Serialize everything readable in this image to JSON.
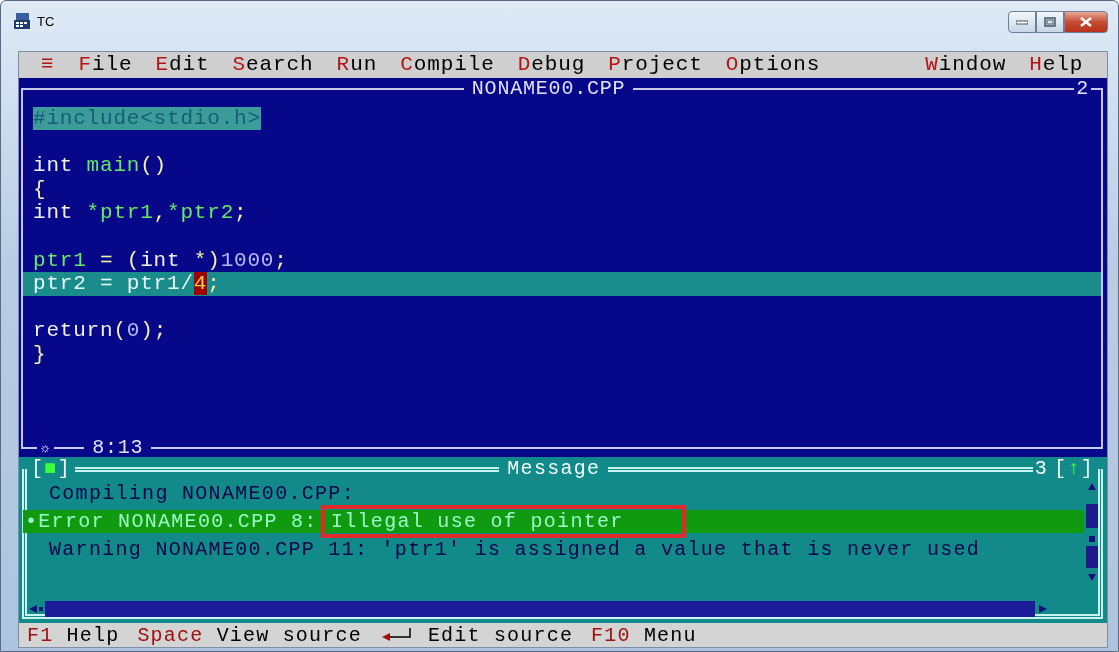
{
  "window": {
    "title": "TC"
  },
  "menu": [
    {
      "label": "≡",
      "kind": "system"
    },
    {
      "label": "File",
      "kind": "menu"
    },
    {
      "label": "Edit",
      "kind": "menu"
    },
    {
      "label": "Search",
      "kind": "menu"
    },
    {
      "label": "Run",
      "kind": "menu"
    },
    {
      "label": "Compile",
      "kind": "menu"
    },
    {
      "label": "Debug",
      "kind": "menu"
    },
    {
      "label": "Project",
      "kind": "menu"
    },
    {
      "label": "Options",
      "kind": "menu"
    },
    {
      "label": "Window",
      "kind": "right"
    },
    {
      "label": "Help",
      "kind": "menu"
    }
  ],
  "editor": {
    "title": "NONAME00.CPP",
    "number": "2",
    "modified_marker": "☼",
    "position": "8:13",
    "lines": [
      {
        "kind": "block",
        "tokens": [
          {
            "text": "#include<stdio.h>",
            "kind": "directive"
          }
        ]
      },
      {
        "kind": "blank"
      },
      {
        "kind": "normal",
        "tokens": [
          {
            "text": "int ",
            "kind": "keyword"
          },
          {
            "text": "main",
            "kind": "ident"
          },
          {
            "text": "()",
            "kind": "symbol"
          }
        ]
      },
      {
        "kind": "normal",
        "tokens": [
          {
            "text": "{",
            "kind": "symbol"
          }
        ]
      },
      {
        "kind": "normal",
        "tokens": [
          {
            "text": "int ",
            "kind": "keyword"
          },
          {
            "text": "*ptr1",
            "kind": "ident"
          },
          {
            "text": ",",
            "kind": "symbol"
          },
          {
            "text": "*ptr2",
            "kind": "ident"
          },
          {
            "text": ";",
            "kind": "symbol"
          }
        ]
      },
      {
        "kind": "blank"
      },
      {
        "kind": "normal",
        "tokens": [
          {
            "text": "ptr1",
            "kind": "ident"
          },
          {
            "text": " = (",
            "kind": "symbol"
          },
          {
            "text": "int ",
            "kind": "keyword"
          },
          {
            "text": "*)",
            "kind": "symbol"
          },
          {
            "text": "1000",
            "kind": "number"
          },
          {
            "text": ";",
            "kind": "symbol"
          }
        ]
      },
      {
        "kind": "current",
        "tokens": [
          {
            "text": "ptr2 = ptr1/",
            "kind": "plain"
          },
          {
            "text": "4",
            "kind": "cursor"
          },
          {
            "text": ";",
            "kind": "symbol"
          }
        ]
      },
      {
        "kind": "blank"
      },
      {
        "kind": "normal",
        "tokens": [
          {
            "text": "return",
            "kind": "keyword"
          },
          {
            "text": "(",
            "kind": "symbol"
          },
          {
            "text": "0",
            "kind": "number"
          },
          {
            "text": ");",
            "kind": "symbol"
          }
        ]
      },
      {
        "kind": "normal",
        "tokens": [
          {
            "text": "}",
            "kind": "symbol"
          }
        ]
      }
    ]
  },
  "messages": {
    "title": "Message",
    "number": "3",
    "close_box": "[■]",
    "zoom_box": "[↑]",
    "items": [
      {
        "text": "Compiling NONAME00.CPP:",
        "selected": false
      },
      {
        "bullet": "•",
        "text": "Error NONAME00.CPP 8: Illegal use of pointer",
        "selected": true
      },
      {
        "text": "Warning NONAME00.CPP 11: 'ptr1' is assigned a value that is never used",
        "selected": false
      }
    ]
  },
  "status_bar": [
    {
      "key": "F1",
      "label": "Help",
      "kind": "key"
    },
    {
      "key": "Space",
      "label": "View source",
      "kind": "key"
    },
    {
      "label": "Edit source",
      "kind": "enter"
    },
    {
      "key": "F10",
      "label": "Menu",
      "kind": "key"
    }
  ]
}
